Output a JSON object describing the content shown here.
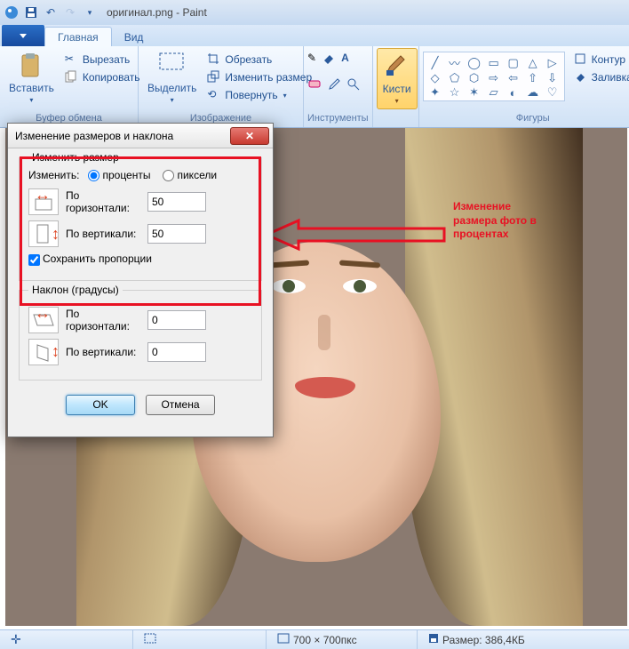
{
  "title": "оригинал.png - Paint",
  "tabs": {
    "main": "Главная",
    "view": "Вид"
  },
  "clipboard": {
    "paste": "Вставить",
    "cut": "Вырезать",
    "copy": "Копировать",
    "group": "Буфер обмена"
  },
  "image": {
    "select": "Выделить",
    "crop": "Обрезать",
    "resize": "Изменить размер",
    "rotate": "Повернуть",
    "group": "Изображение"
  },
  "tools": {
    "group": "Инструменты"
  },
  "brushes": {
    "label": "Кисти"
  },
  "shapes": {
    "outline": "Контур",
    "fill": "Заливка",
    "group": "Фигуры"
  },
  "dialog": {
    "title": "Изменение размеров и наклона",
    "resize_legend": "Изменить размер",
    "by_label": "Изменить:",
    "percent": "проценты",
    "pixels": "пиксели",
    "horizontal": "По горизонтали:",
    "vertical": "По вертикали:",
    "h_value": "50",
    "v_value": "50",
    "keep_ratio": "Сохранить пропорции",
    "skew_legend": "Наклон (градусы)",
    "skew_h": "0",
    "skew_v": "0",
    "ok": "OK",
    "cancel": "Отмена"
  },
  "annotation": {
    "line1": "Изменение",
    "line2": "размера фото в",
    "line3": "процентах"
  },
  "status": {
    "dims": "700 × 700пкс",
    "size": "Размер: 386,4КБ"
  }
}
